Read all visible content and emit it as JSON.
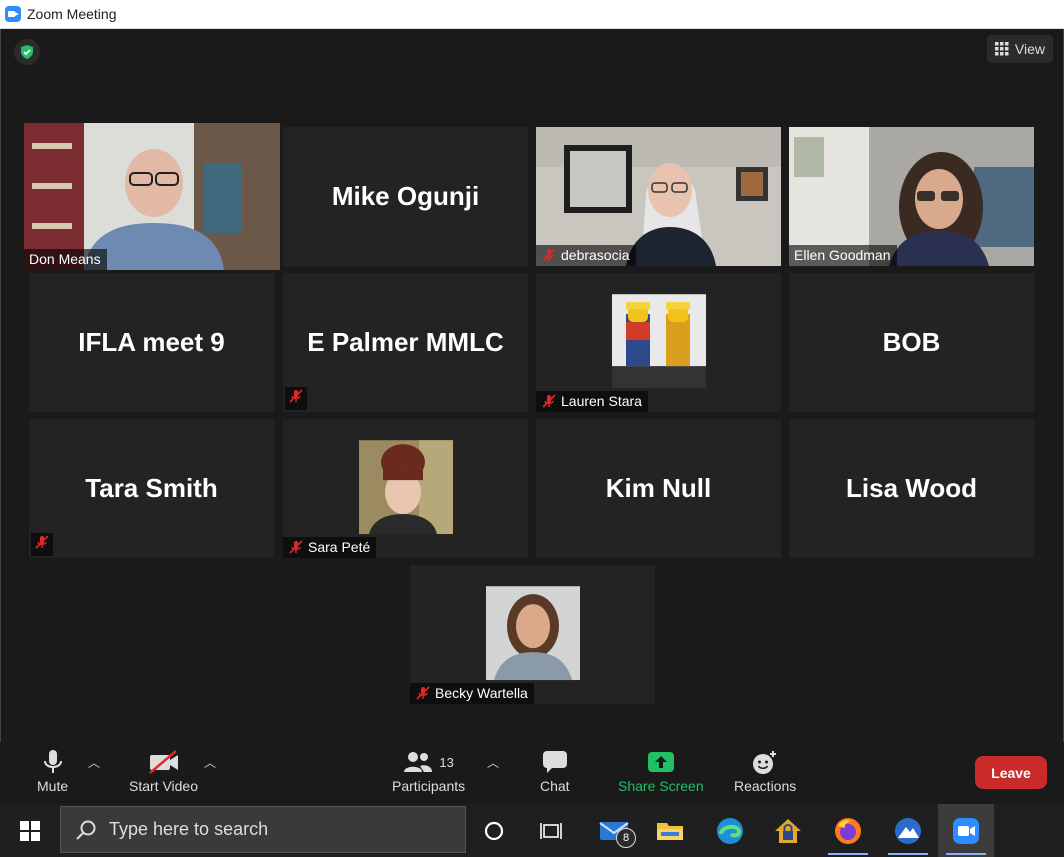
{
  "window": {
    "title": "Zoom Meeting"
  },
  "header": {
    "view_label": "View"
  },
  "tiles": {
    "don": {
      "name": "Don Means"
    },
    "mike": {
      "name": "Mike Ogunji"
    },
    "debra": {
      "name": "debrasocia"
    },
    "ellen": {
      "name": "Ellen Goodman"
    },
    "ifla": {
      "name": "IFLA meet 9"
    },
    "palmer": {
      "name": "E Palmer MMLC"
    },
    "lauren": {
      "name": "Lauren Stara"
    },
    "bob": {
      "name": "BOB"
    },
    "tara": {
      "name": "Tara Smith"
    },
    "sara": {
      "name": "Sara Peté"
    },
    "kim": {
      "name": "Kim Null"
    },
    "lisa": {
      "name": "Lisa Wood"
    },
    "becky": {
      "name": "Becky Wartella"
    }
  },
  "toolbar": {
    "mute": "Mute",
    "start_video": "Start Video",
    "participants": "Participants",
    "participant_count": "13",
    "chat": "Chat",
    "share_screen": "Share Screen",
    "reactions": "Reactions",
    "leave": "Leave"
  },
  "taskbar": {
    "search_placeholder": "Type here to search",
    "mail_badge": "8"
  },
  "colors": {
    "speaker_highlight": "#c3e05a",
    "share_green": "#21c065",
    "leave_red": "#c92a2a",
    "mute_red": "#e02828"
  }
}
